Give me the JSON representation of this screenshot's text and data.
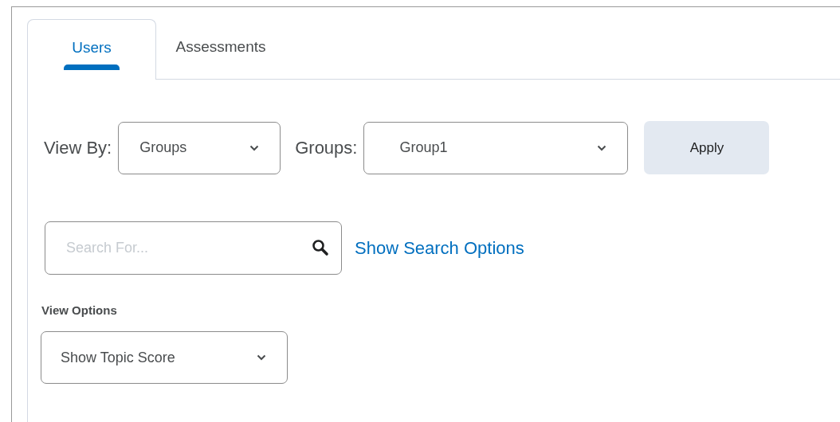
{
  "tabs": [
    {
      "label": "Users",
      "selected": true
    },
    {
      "label": "Assessments",
      "selected": false
    }
  ],
  "view_by": {
    "label": "View By:",
    "value": "Groups"
  },
  "groups": {
    "label": "Groups:",
    "value": "Group1"
  },
  "apply_button": "Apply",
  "search": {
    "placeholder": "Search For...",
    "link": "Show Search Options"
  },
  "view_options": {
    "label": "View Options",
    "value": "Show Topic Score"
  }
}
